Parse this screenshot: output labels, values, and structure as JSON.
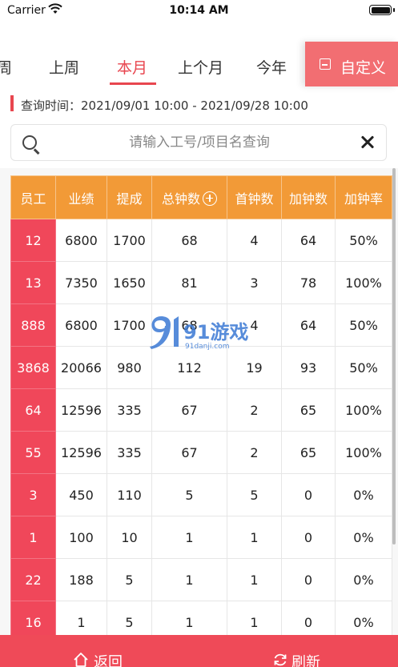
{
  "status_bar": {
    "carrier": "Carrier",
    "time": "10:14 AM"
  },
  "tabs": [
    "周",
    "上周",
    "本月",
    "上个月",
    "今年"
  ],
  "active_tab": "本月",
  "custom_button": {
    "label": "自定义"
  },
  "query": {
    "label": "查询时间：",
    "range": "2021/09/01 10:00 - 2021/09/28 10:00"
  },
  "search": {
    "placeholder": "请输入工号/项目名查询",
    "value": ""
  },
  "table": {
    "columns": [
      "员工",
      "业绩",
      "提成",
      "总钟数",
      "首钟数",
      "加钟数",
      "加钟率"
    ],
    "rows": [
      [
        "12",
        "6800",
        "1700",
        "68",
        "4",
        "64",
        "50%"
      ],
      [
        "13",
        "7350",
        "1650",
        "81",
        "3",
        "78",
        "100%"
      ],
      [
        "888",
        "6800",
        "1700",
        "68",
        "4",
        "64",
        "50%"
      ],
      [
        "3868",
        "20066",
        "980",
        "112",
        "19",
        "93",
        "50%"
      ],
      [
        "64",
        "12596",
        "335",
        "67",
        "2",
        "65",
        "100%"
      ],
      [
        "55",
        "12596",
        "335",
        "67",
        "2",
        "65",
        "100%"
      ],
      [
        "3",
        "450",
        "110",
        "5",
        "5",
        "0",
        "0%"
      ],
      [
        "1",
        "100",
        "10",
        "1",
        "1",
        "0",
        "0%"
      ],
      [
        "22",
        "188",
        "5",
        "1",
        "1",
        "0",
        "0%"
      ],
      [
        "16",
        "1",
        "5",
        "1",
        "1",
        "0",
        "0%"
      ]
    ]
  },
  "watermark": {
    "brand": "91游戏",
    "site": "91danji.com"
  },
  "bottom": {
    "back": "返回",
    "refresh": "刷新"
  },
  "colors": {
    "accent": "#e8464f",
    "header": "#f29a37",
    "employee_cell": "#f0475a",
    "custom_button": "#f26e72"
  }
}
